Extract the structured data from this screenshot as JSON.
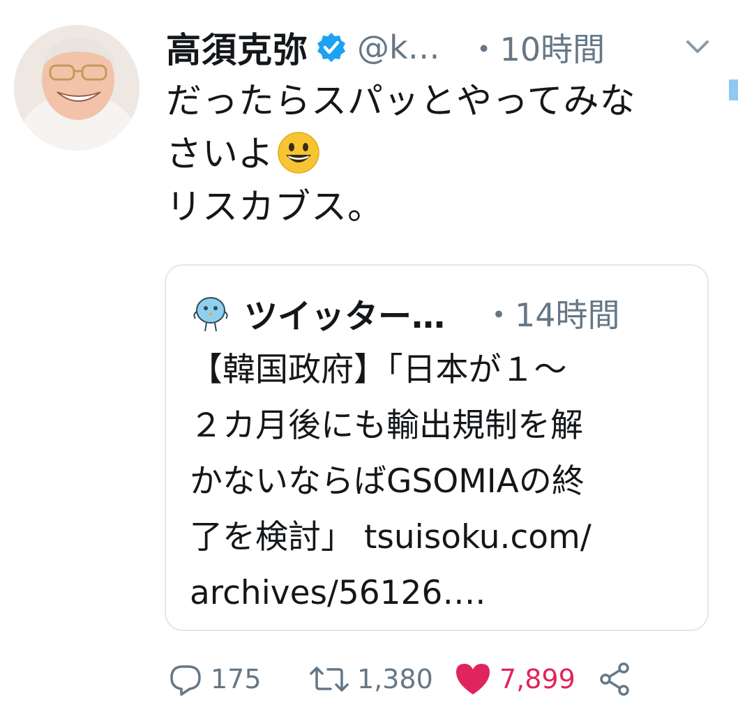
{
  "tweet": {
    "author": {
      "display_name": "高須克弥",
      "handle": "@k…",
      "verified": true
    },
    "time": "・10時間",
    "text_lines": [
      "だったらスパッとやってみな",
      "さいよ",
      "リスカブス。"
    ],
    "emoji": "grinning-face",
    "quoted_tweet": {
      "author_name": "ツイッター…",
      "time": "・14時間",
      "text_lines": [
        "【韓国政府】「日本が１〜",
        "２カ月後にも輸出規制を解",
        "かないならばGSOMIAの終",
        "了を検討」 tsuisoku.com/",
        "archives/56126…."
      ]
    },
    "actions": {
      "reply_count": "175",
      "retweet_count": "1,380",
      "like_count": "7,899",
      "liked": true
    }
  },
  "colors": {
    "text": "#14171a",
    "secondary": "#657786",
    "verified": "#1da1f2",
    "like": "#e0245e",
    "border": "#e1e8ed"
  },
  "icons": {
    "verified": "verified-badge-icon",
    "caret": "chevron-down-icon",
    "reply": "reply-icon",
    "retweet": "retweet-icon",
    "like": "heart-icon",
    "share": "share-icon"
  }
}
